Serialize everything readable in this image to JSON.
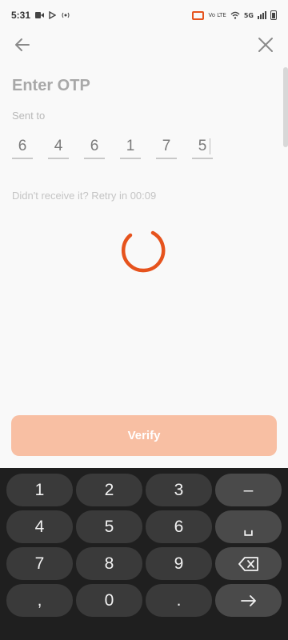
{
  "status_bar": {
    "time": "5:31",
    "network_label": "5G",
    "volte_label": "Vo LTE"
  },
  "nav": {
    "back_icon": "arrow-left-icon",
    "close_icon": "close-icon"
  },
  "screen": {
    "title": "Enter OTP",
    "sent_to_label": "Sent to",
    "otp_digits": [
      "6",
      "4",
      "6",
      "1",
      "7",
      "5"
    ],
    "retry_text": "Didn't receive it? Retry in 00:09",
    "verify_label": "Verify"
  },
  "colors": {
    "accent": "#e6531d",
    "verify_button_disabled": "#f8bfa3",
    "keyboard_bg": "#1f1f1f",
    "key_bg": "#3a3a3a"
  },
  "keyboard": {
    "row1": [
      "1",
      "2",
      "3",
      "–"
    ],
    "row2": [
      "4",
      "5",
      "6",
      "␣"
    ],
    "row3": [
      "7",
      "8",
      "9"
    ],
    "row3_func_icon": "backspace-icon",
    "row4": [
      ",",
      "0",
      "."
    ],
    "row4_func_icon": "arrow-right-icon"
  }
}
